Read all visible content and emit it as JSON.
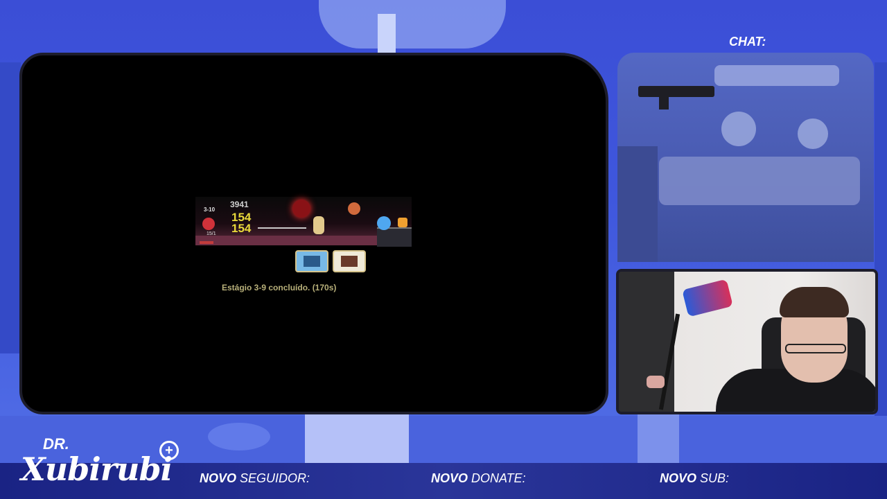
{
  "game": {
    "stage_tag": "3-10",
    "gold": "3941",
    "damage_1": "154",
    "damage_2": "154",
    "hp_tag": "15/1",
    "stage_message": "Estágio 3-9 concluído. (170s)"
  },
  "chat": {
    "label": "CHAT:"
  },
  "logo": {
    "prefix": "DR.",
    "name": "Xubirubi",
    "plus": "+"
  },
  "alerts": {
    "follower_bold": "NOVO",
    "follower_rest": " SEGUIDOR:",
    "donate_bold": "NOVO",
    "donate_rest": " DONATE:",
    "sub_bold": "NOVO",
    "sub_rest": " SUB:"
  }
}
